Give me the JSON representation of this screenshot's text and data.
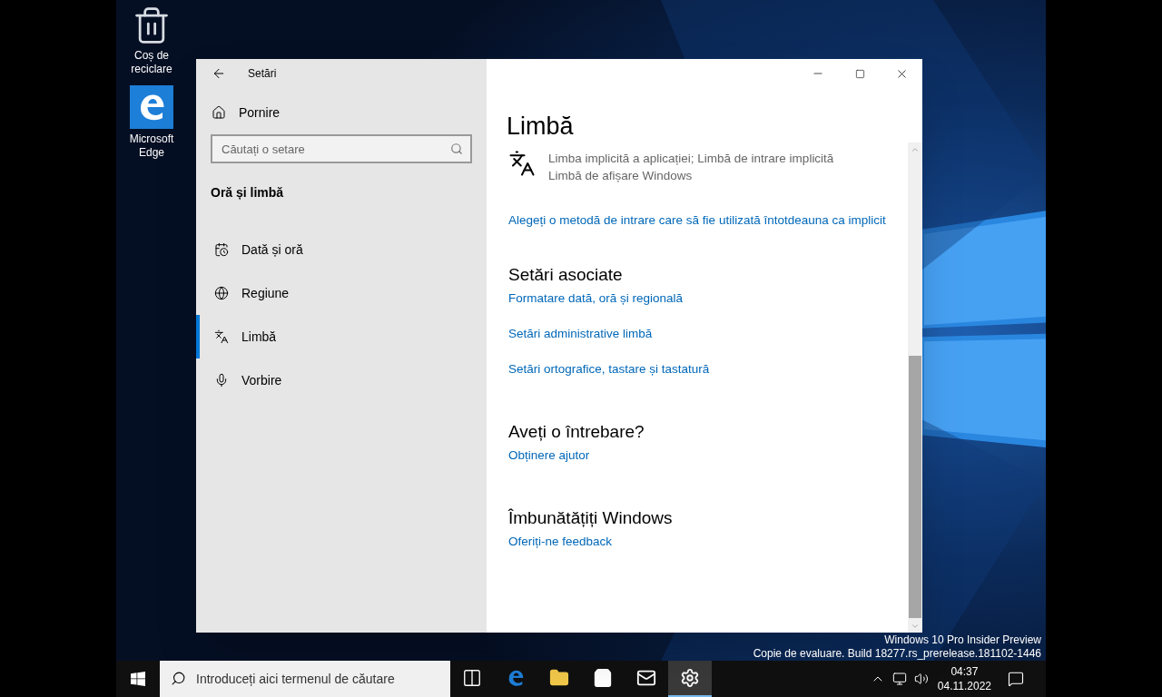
{
  "desktop_icons": [
    {
      "kind": "recycle",
      "label": "Coș de reciclare"
    },
    {
      "kind": "edge",
      "label": "Microsoft Edge"
    }
  ],
  "window": {
    "title": "Setări",
    "home": "Pornire",
    "search": {
      "placeholder": "Căutați o setare"
    },
    "section": "Oră și limbă",
    "nav": [
      {
        "kind": "calendar",
        "label": "Dată și oră",
        "selected": false
      },
      {
        "kind": "globe",
        "label": "Regiune",
        "selected": false
      },
      {
        "kind": "language",
        "label": "Limbă",
        "selected": true
      },
      {
        "kind": "mic",
        "label": "Vorbire",
        "selected": false
      }
    ],
    "page_title": "Limbă",
    "language_item": {
      "description": "Limba implicită a aplicației; Limbă de intrare implicită",
      "note": "Limbă de afișare Windows"
    },
    "input_method_link": "Alegeți o metodă de intrare care să fie utilizată întotdeauna ca implicit",
    "groups": [
      {
        "heading": "Setări asociate",
        "links": [
          "Formatare dată, oră și regională",
          "Setări administrative limbă",
          "Setări ortografice, tastare și tastatură"
        ]
      },
      {
        "heading": "Aveți o întrebare?",
        "links": [
          "Obținere ajutor"
        ]
      },
      {
        "heading": "Îmbunătățiți Windows",
        "links": [
          "Oferiți-ne feedback"
        ]
      }
    ]
  },
  "watermark": [
    "Windows 10 Pro Insider Preview",
    "Copie de evaluare. Build 18277.rs_prerelease.181102-1446"
  ],
  "taskbar": {
    "search": {
      "placeholder": "Introduceți aici termenul de căutare"
    },
    "apps": [
      {
        "kind": "taskview",
        "selected": false
      },
      {
        "kind": "edge",
        "selected": false
      },
      {
        "kind": "explorer",
        "selected": false
      },
      {
        "kind": "store",
        "selected": false
      },
      {
        "kind": "mail",
        "selected": false
      },
      {
        "kind": "settings",
        "selected": true
      }
    ],
    "time": "04:37",
    "date": "04.11.2022"
  }
}
